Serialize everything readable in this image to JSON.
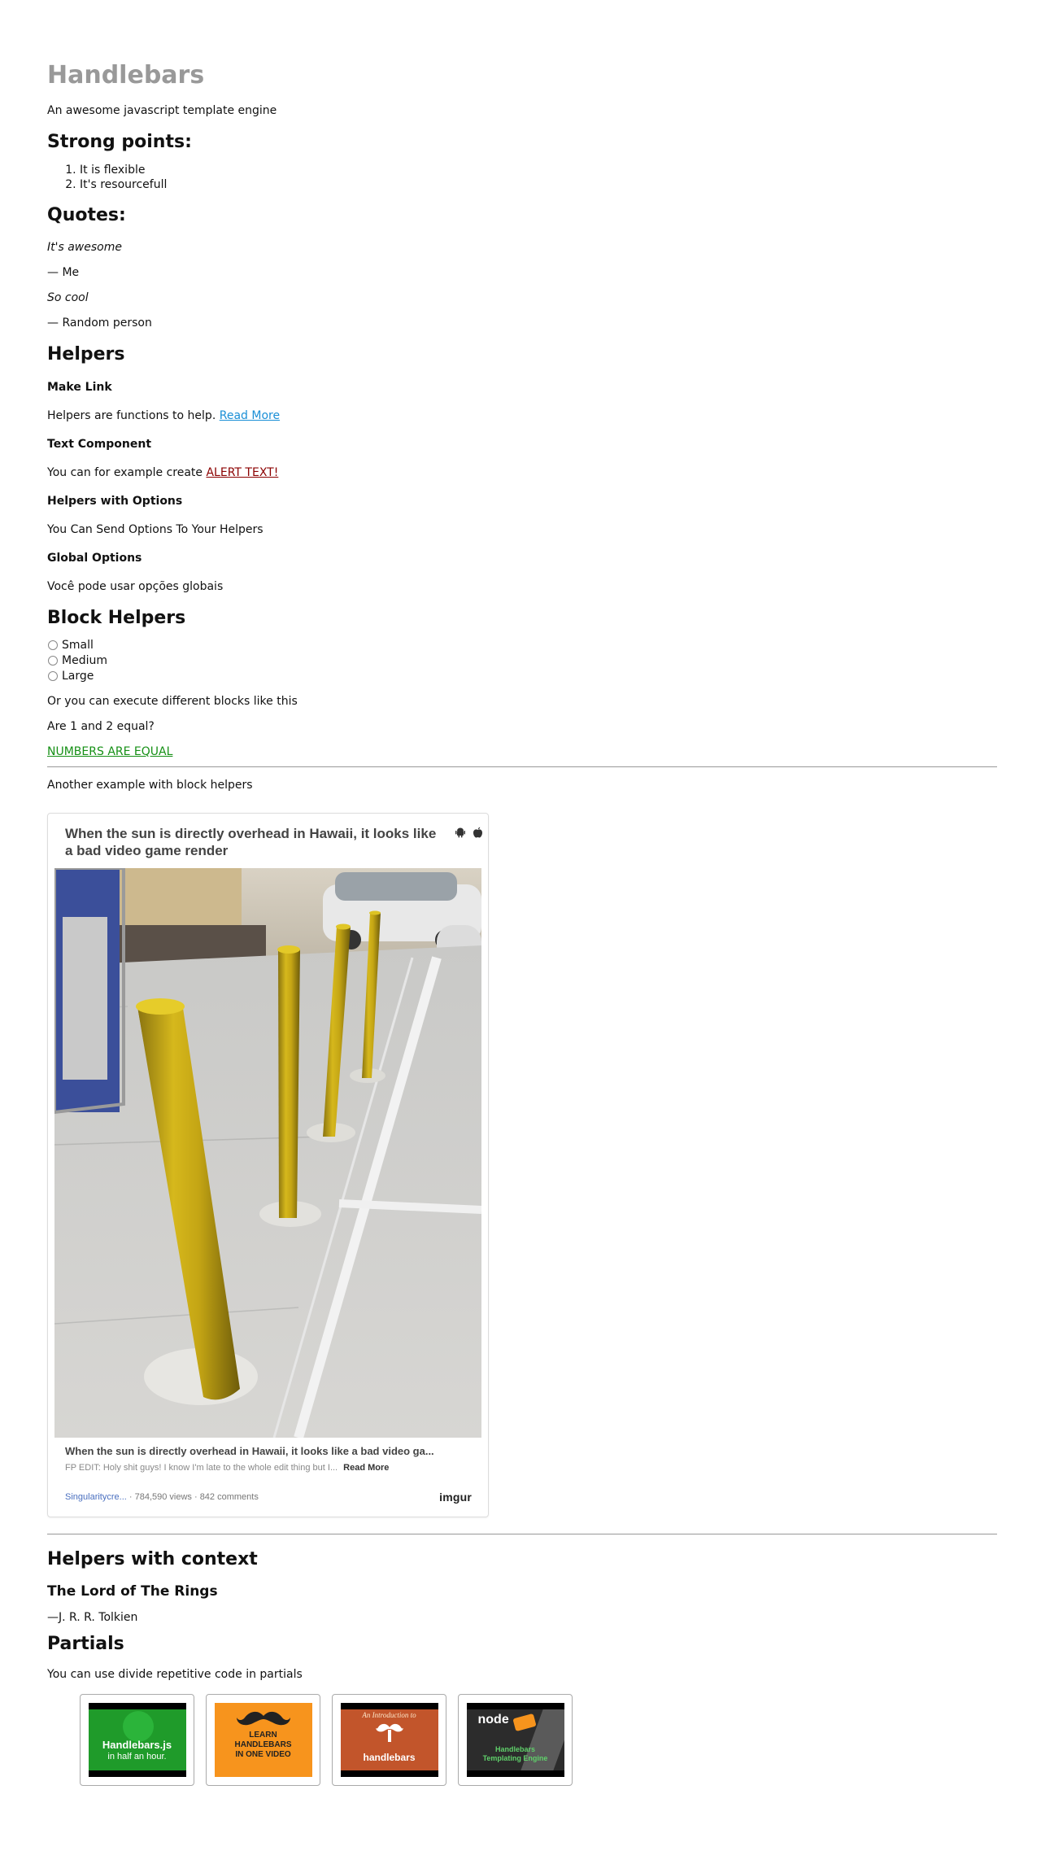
{
  "header": {
    "title": "Handlebars",
    "subtitle": "An awesome javascript template engine"
  },
  "strong_points": {
    "heading": "Strong points:",
    "items": [
      "It is flexible",
      "It's resourcefull"
    ]
  },
  "quotes": {
    "heading": "Quotes:",
    "items": [
      {
        "text": "It's awesome",
        "author": "— Me"
      },
      {
        "text": "So cool",
        "author": "— Random person"
      }
    ]
  },
  "helpers": {
    "heading": "Helpers",
    "make_link": {
      "heading": "Make Link",
      "text": "Helpers are functions to help.",
      "link_label": "Read More"
    },
    "text_component": {
      "heading": "Text Component",
      "text": "You can for example create",
      "alert_text": "ALERT TEXT!"
    },
    "with_options": {
      "heading": "Helpers with Options",
      "text": "You Can Send Options To Your Helpers"
    },
    "global_options": {
      "heading": "Global Options",
      "text": "Você pode usar opções globais"
    }
  },
  "block_helpers": {
    "heading": "Block Helpers",
    "radio_options": [
      "Small",
      "Medium",
      "Large"
    ],
    "blocks_text": "Or you can execute different blocks like this",
    "question": "Are 1 and 2 equal?",
    "result": "NUMBERS ARE EQUAL",
    "another_example": "Another example with block helpers"
  },
  "imgur_embed": {
    "title": "When the sun is directly overhead in Hawaii, it looks like a bad video game render",
    "caption": "When the sun is directly overhead in Hawaii, it looks like a bad video ga...",
    "description": "FP EDIT: Holy shit guys! I know I'm late to the whole edit thing but I...",
    "read_more": "Read More",
    "author": "Singularitycre...",
    "stats": "· 784,590 views · 842 comments",
    "logo": "imgur",
    "icons": [
      "android-icon",
      "apple-icon"
    ]
  },
  "helpers_context": {
    "heading": "Helpers with context",
    "book_title": "The Lord of The Rings",
    "author": "—J. R. R. Tolkien"
  },
  "partials": {
    "heading": "Partials",
    "text": "You can use divide repetitive code in partials",
    "thumbnails": [
      {
        "line1": "Handlebars.js",
        "line2": "in half an hour.",
        "color": "#1f9b2a"
      },
      {
        "line1": "LEARN",
        "line2": "HANDLEBARS",
        "line3": "IN ONE VIDEO",
        "color": "#f7941d"
      },
      {
        "line1": "An Introduction to",
        "line2": "handlebars",
        "color": "#c2552b"
      },
      {
        "line1": "node",
        "line2": "Handlebars",
        "line3": "Templating Engine",
        "color": "#2c2c2c"
      }
    ]
  },
  "colors": {
    "title_gray": "#999999",
    "link_blue": "#1a8fd6",
    "alert_red": "#8b0000",
    "equal_green": "#169016"
  }
}
